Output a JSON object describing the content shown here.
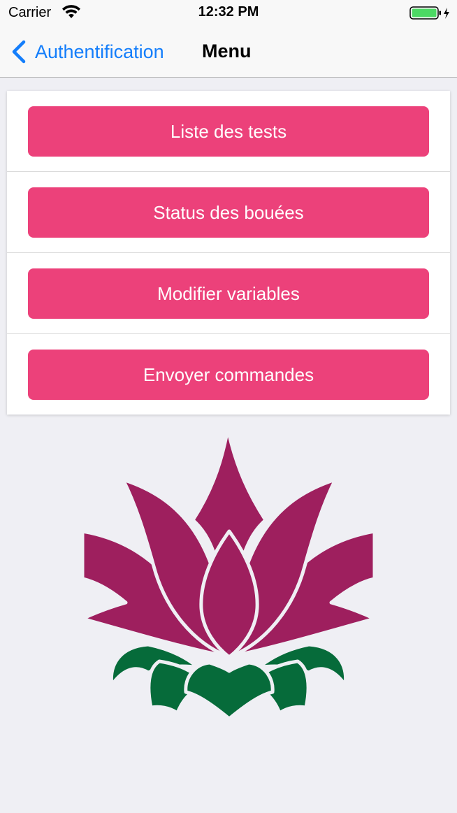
{
  "status_bar": {
    "carrier": "Carrier",
    "time": "12:32 PM",
    "battery_color": "#4cd964"
  },
  "nav": {
    "back_label": "Authentification",
    "title": "Menu",
    "accent": "#147efb"
  },
  "menu": {
    "button_color": "#ec417a",
    "items": [
      {
        "label": "Liste des tests"
      },
      {
        "label": "Status des bouées"
      },
      {
        "label": "Modifier variables"
      },
      {
        "label": "Envoyer commandes"
      }
    ]
  },
  "logo": {
    "icon": "lotus-flower-icon",
    "petal_color": "#9e1f5e",
    "leaf_color": "#066b3a"
  }
}
